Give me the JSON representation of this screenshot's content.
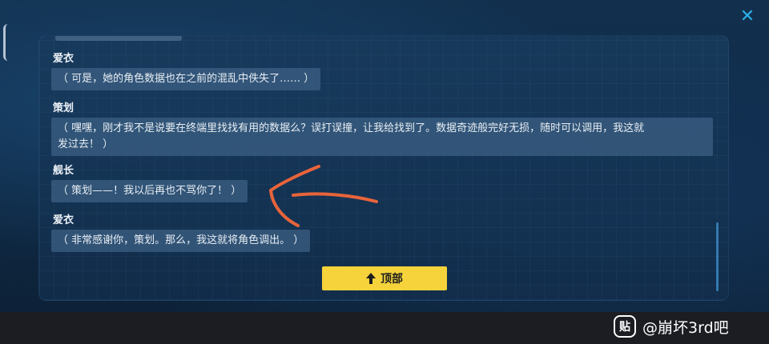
{
  "close_glyph": "✕",
  "dialogue": [
    {
      "speaker": "爱衣",
      "lines": [
        "（ 可是，她的角色数据也在之前的混乱中佚失了…… ）"
      ]
    },
    {
      "speaker": "策划",
      "lines": [
        "（ 嘿嘿，刚才我不是说要在终端里找找有用的数据么？误打误撞，让我给找到了。数据奇迹般完好无损，随时可以调用，我这就",
        "发过去！ ）"
      ]
    },
    {
      "speaker": "舰长",
      "lines": [
        "（ 策划——！我以后再也不骂你了！ ）"
      ]
    },
    {
      "speaker": "爱衣",
      "lines": [
        "（ 非常感谢你，策划。那么，我这就将角色调出。 ）"
      ]
    }
  ],
  "top_button": {
    "label": "顶部",
    "icon": "arrow-up-icon"
  },
  "watermark": {
    "icon_text": "贴",
    "text": "@崩坏3rd吧"
  },
  "colors": {
    "accent_yellow": "#f6d33a",
    "close_blue": "#2bb0e8",
    "annotation_orange": "#e8643a",
    "bubble_bg": "#3a5e82"
  }
}
